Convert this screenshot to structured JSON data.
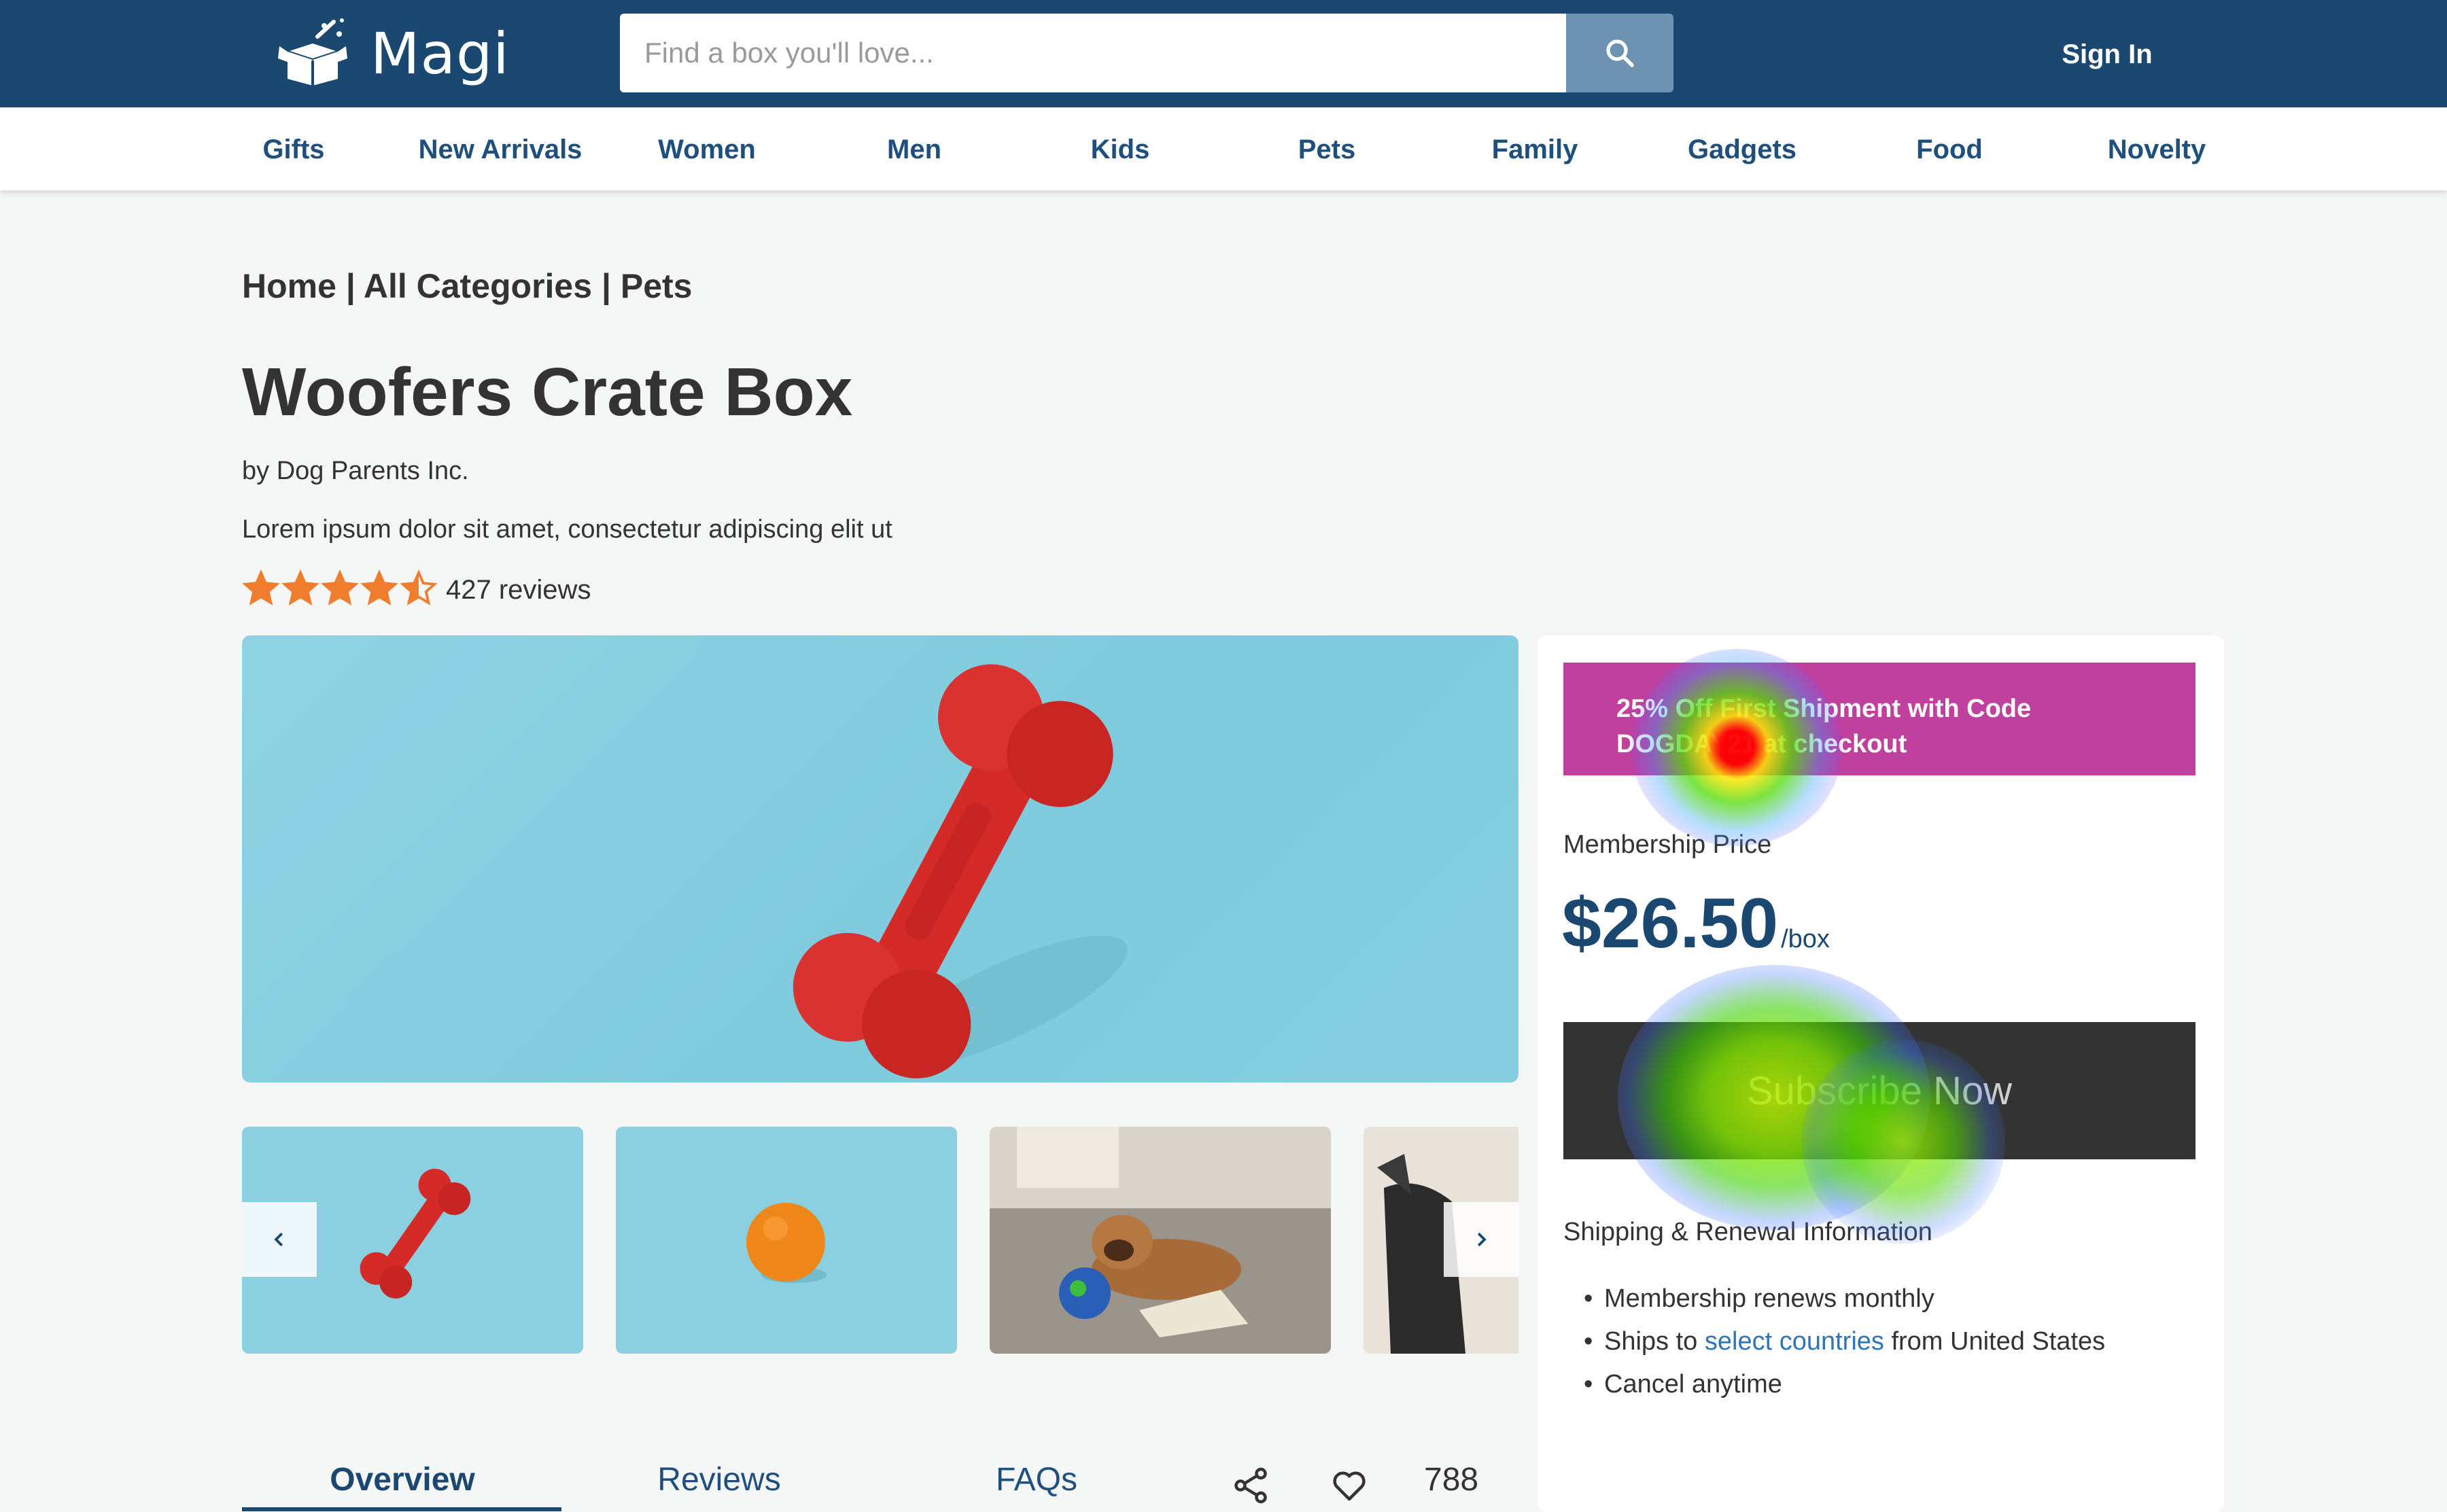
{
  "header": {
    "logo_text": "Magi",
    "search_placeholder": "Find a box you'll love...",
    "signin_label": "Sign In"
  },
  "categories": [
    "Gifts",
    "New Arrivals",
    "Women",
    "Men",
    "Kids",
    "Pets",
    "Family",
    "Gadgets",
    "Food",
    "Novelty"
  ],
  "breadcrumb": {
    "home": "Home",
    "sep": " | ",
    "all": "All Categories",
    "current": "Pets"
  },
  "product": {
    "title": "Woofers Crate Box",
    "byline": "by Dog Parents Inc.",
    "description": "Lorem ipsum dolor sit amet, consectetur adipiscing elit ut",
    "rating": 4.5,
    "review_count": "427 reviews"
  },
  "tabs": {
    "overview": "Overview",
    "reviews": "Reviews",
    "faqs": "FAQs"
  },
  "like_count": "788",
  "panel": {
    "promo_line1": "25% Off First Shipment with Code",
    "promo_line2": "DOGDAY21 at checkout",
    "membership_label": "Membership Price",
    "price": "$26.50",
    "per_unit": "/box",
    "subscribe_label": "Subscribe Now",
    "shipping_label": "Shipping & Renewal Information",
    "shipping_items": {
      "renews": "Membership renews monthly",
      "ships_prefix": "Ships to ",
      "ships_link": "select countries",
      "ships_suffix": " from United States",
      "cancel": "Cancel anytime"
    }
  },
  "colors": {
    "header_bg": "#1b4870",
    "promo_bg": "#c0409d",
    "price": "#1b4870",
    "subscribe_bg": "#333333",
    "link": "#2f75b6"
  }
}
